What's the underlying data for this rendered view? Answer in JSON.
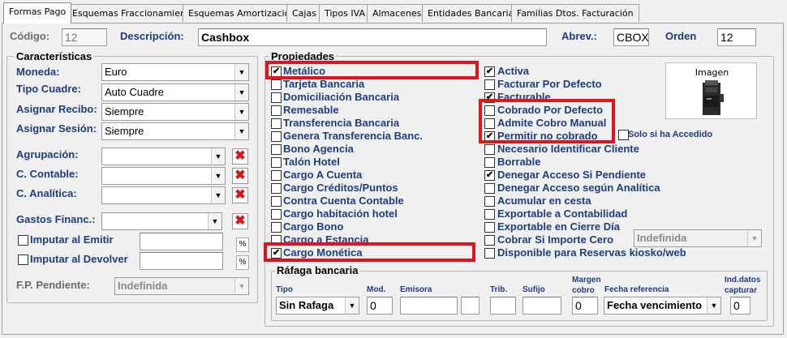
{
  "tabs": [
    "Formas Pago",
    "Esquemas Fraccionamiento",
    "Esquemas Amortización",
    "Cajas",
    "Tipos IVA",
    "Almacenes",
    "Entidades Bancarias",
    "Familias Dtos. Facturación"
  ],
  "header": {
    "codigo_label": "Código:",
    "codigo_value": "12",
    "descripcion_label": "Descripción:",
    "descripcion_value": "Cashbox",
    "abrev_label": "Abrev.:",
    "abrev_value": "CBOX",
    "orden_label": "Orden",
    "orden_value": "12"
  },
  "caracteristicas": {
    "title": "Características",
    "moneda_label": "Moneda:",
    "moneda_value": "Euro",
    "tipo_cuadre_label": "Tipo Cuadre:",
    "tipo_cuadre_value": "Auto Cuadre",
    "asignar_recibo_label": "Asignar Recibo:",
    "asignar_recibo_value": "Siempre",
    "asignar_sesion_label": "Asignar Sesión:",
    "asignar_sesion_value": "Siempre",
    "agrupacion_label": "Agrupación:",
    "c_contable_label": "C. Contable:",
    "c_analitica_label": "C. Analítica:",
    "gastos_label": "Gastos Financ.:",
    "imputar_emitir_label": "Imputar al Emitir",
    "imputar_devolver_label": "Imputar al Devolver",
    "pct_symbol": "%",
    "fp_pendiente_label": "F.P. Pendiente:",
    "fp_pendiente_value": "Indefinida"
  },
  "propiedades": {
    "title": "Propiedades",
    "left": [
      {
        "label": "Metálico",
        "checked": true
      },
      {
        "label": "Tarjeta Bancaria",
        "checked": false
      },
      {
        "label": "Domiciliación Bancaria",
        "checked": false
      },
      {
        "label": "Remesable",
        "checked": false
      },
      {
        "label": "Transferencia Bancaria",
        "checked": false
      },
      {
        "label": "Genera Transferencia Banc.",
        "checked": false
      },
      {
        "label": "Bono Agencia",
        "checked": false
      },
      {
        "label": "Talón Hotel",
        "checked": false
      },
      {
        "label": "Cargo A Cuenta",
        "checked": false
      },
      {
        "label": "Cargo Créditos/Puntos",
        "checked": false
      },
      {
        "label": "Contra Cuenta Contable",
        "checked": false
      },
      {
        "label": "Cargo habitación hotel",
        "checked": false
      },
      {
        "label": "Cargo Bono",
        "checked": false
      },
      {
        "label": "Cargo a Estancia",
        "checked": false
      },
      {
        "label": "Cargo Monética",
        "checked": true
      }
    ],
    "right": [
      {
        "label": "Activa",
        "checked": true
      },
      {
        "label": "Facturar Por Defecto",
        "checked": false
      },
      {
        "label": "Facturable",
        "checked": true
      },
      {
        "label": "Cobrado Por Defecto",
        "checked": false
      },
      {
        "label": "Admite Cobro Manual",
        "checked": false
      },
      {
        "label": "Permitir no cobrado",
        "checked": true
      },
      {
        "label": "Necesario Identificar Cliente",
        "checked": false
      },
      {
        "label": "Borrable",
        "checked": false
      },
      {
        "label": "Denegar Acceso Si Pendiente",
        "checked": true
      },
      {
        "label": "Denegar Acceso según Analítica",
        "checked": false
      },
      {
        "label": "Acumular en cesta",
        "checked": false
      },
      {
        "label": "Exportable a Contabilidad",
        "checked": false
      },
      {
        "label": "Exportable en Cierre Día",
        "checked": false
      },
      {
        "label": "Cobrar Si Importe Cero",
        "checked": false
      },
      {
        "label": "Disponible para Reservas kiosko/web",
        "checked": false
      }
    ],
    "solo_accedido_label": "Solo si ha Accedido",
    "cobrar_cero_value": "Indefinida",
    "imagen_label": "Imagen"
  },
  "rafaga": {
    "title": "Ráfaga bancaria",
    "tipo_label": "Tipo",
    "tipo_value": "Sin Rafaga",
    "mod_label": "Mod.",
    "mod_value": "0",
    "emisora_label": "Emisora",
    "trib_label": "Trib.",
    "sufijo_label": "Sufijo",
    "margen_label_1": "Margen",
    "margen_label_2": "cobro",
    "margen_value": "0",
    "fecha_ref_label": "Fecha referencia",
    "fecha_ref_value": "Fecha vencimiento",
    "ind_label_1": "Ind.datos",
    "ind_label_2": "capturar",
    "ind_value": "0"
  },
  "colors": {
    "label_blue": "#1e3c82",
    "highlight_red": "#e0141a",
    "delete_red": "#d01818"
  }
}
